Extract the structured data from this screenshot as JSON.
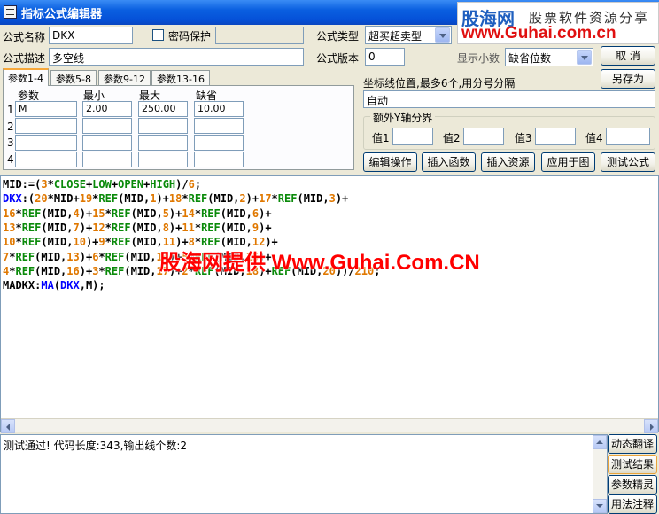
{
  "window": {
    "title": "指标公式编辑器"
  },
  "watermark": {
    "logo": "股海网",
    "tagline": "股票软件资源分享",
    "url": "www.Guhai.com.cn",
    "overlay": "股海网提供 Www.Guhai.Com.CN"
  },
  "form": {
    "name_label": "公式名称",
    "name_value": "DKX",
    "password_label": "密码保护",
    "type_label": "公式类型",
    "type_value": "超买超卖型",
    "desc_label": "公式描述",
    "desc_value": "多空线",
    "version_label": "公式版本",
    "version_value": "0",
    "decimal_label": "显示小数",
    "decimal_value": "缺省位数"
  },
  "buttons": {
    "cancel": "取 消",
    "save_as": "另存为",
    "edit_ops": "编辑操作",
    "insert_func": "插入函数",
    "insert_resource": "插入资源",
    "apply_chart": "应用于图",
    "test_formula": "测试公式",
    "dyn_translate": "动态翻译",
    "test_result": "测试结果",
    "param_wizard": "参数精灵",
    "usage_notes": "用法注释"
  },
  "tabs": [
    "参数1-4",
    "参数5-8",
    "参数9-12",
    "参数13-16"
  ],
  "params": {
    "headers": [
      "参数",
      "最小",
      "最大",
      "缺省"
    ],
    "rows": [
      {
        "idx": "1",
        "name": "M",
        "min": "2.00",
        "max": "250.00",
        "def": "10.00"
      },
      {
        "idx": "2",
        "name": "",
        "min": "",
        "max": "",
        "def": ""
      },
      {
        "idx": "3",
        "name": "",
        "min": "",
        "max": "",
        "def": ""
      },
      {
        "idx": "4",
        "name": "",
        "min": "",
        "max": "",
        "def": ""
      }
    ]
  },
  "axis": {
    "label": "坐标线位置,最多6个,用分号分隔",
    "value": "自动",
    "group_title": "额外Y轴分界",
    "v1": "值1",
    "v2": "值2",
    "v3": "值3",
    "v4": "值4"
  },
  "code_lines": [
    [
      [
        "p",
        "MID:=("
      ],
      [
        "n",
        "3"
      ],
      [
        "p",
        "*"
      ],
      [
        "v",
        "CLOSE"
      ],
      [
        "p",
        "+"
      ],
      [
        "v",
        "LOW"
      ],
      [
        "p",
        "+"
      ],
      [
        "v",
        "OPEN"
      ],
      [
        "p",
        "+"
      ],
      [
        "v",
        "HIGH"
      ],
      [
        "p",
        ")/"
      ],
      [
        "n",
        "6"
      ],
      [
        "p",
        ";"
      ]
    ],
    [
      [
        "f",
        "DKX"
      ],
      [
        "p",
        ":("
      ],
      [
        "n",
        "20"
      ],
      [
        "p",
        "*MID+"
      ],
      [
        "n",
        "19"
      ],
      [
        "p",
        "*"
      ],
      [
        "v",
        "REF"
      ],
      [
        "p",
        "(MID,"
      ],
      [
        "n",
        "1"
      ],
      [
        "p",
        ")+"
      ],
      [
        "n",
        "18"
      ],
      [
        "p",
        "*"
      ],
      [
        "v",
        "REF"
      ],
      [
        "p",
        "(MID,"
      ],
      [
        "n",
        "2"
      ],
      [
        "p",
        ")+"
      ],
      [
        "n",
        "17"
      ],
      [
        "p",
        "*"
      ],
      [
        "v",
        "REF"
      ],
      [
        "p",
        "(MID,"
      ],
      [
        "n",
        "3"
      ],
      [
        "p",
        ")+"
      ]
    ],
    [
      [
        "n",
        "16"
      ],
      [
        "p",
        "*"
      ],
      [
        "v",
        "REF"
      ],
      [
        "p",
        "(MID,"
      ],
      [
        "n",
        "4"
      ],
      [
        "p",
        ")+"
      ],
      [
        "n",
        "15"
      ],
      [
        "p",
        "*"
      ],
      [
        "v",
        "REF"
      ],
      [
        "p",
        "(MID,"
      ],
      [
        "n",
        "5"
      ],
      [
        "p",
        ")+"
      ],
      [
        "n",
        "14"
      ],
      [
        "p",
        "*"
      ],
      [
        "v",
        "REF"
      ],
      [
        "p",
        "(MID,"
      ],
      [
        "n",
        "6"
      ],
      [
        "p",
        ")+"
      ]
    ],
    [
      [
        "n",
        "13"
      ],
      [
        "p",
        "*"
      ],
      [
        "v",
        "REF"
      ],
      [
        "p",
        "(MID,"
      ],
      [
        "n",
        "7"
      ],
      [
        "p",
        ")+"
      ],
      [
        "n",
        "12"
      ],
      [
        "p",
        "*"
      ],
      [
        "v",
        "REF"
      ],
      [
        "p",
        "(MID,"
      ],
      [
        "n",
        "8"
      ],
      [
        "p",
        ")+"
      ],
      [
        "n",
        "11"
      ],
      [
        "p",
        "*"
      ],
      [
        "v",
        "REF"
      ],
      [
        "p",
        "(MID,"
      ],
      [
        "n",
        "9"
      ],
      [
        "p",
        ")+"
      ]
    ],
    [
      [
        "n",
        "10"
      ],
      [
        "p",
        "*"
      ],
      [
        "v",
        "REF"
      ],
      [
        "p",
        "(MID,"
      ],
      [
        "n",
        "10"
      ],
      [
        "p",
        ")+"
      ],
      [
        "n",
        "9"
      ],
      [
        "p",
        "*"
      ],
      [
        "v",
        "REF"
      ],
      [
        "p",
        "(MID,"
      ],
      [
        "n",
        "11"
      ],
      [
        "p",
        ")+"
      ],
      [
        "n",
        "8"
      ],
      [
        "p",
        "*"
      ],
      [
        "v",
        "REF"
      ],
      [
        "p",
        "(MID,"
      ],
      [
        "n",
        "12"
      ],
      [
        "p",
        ")+"
      ]
    ],
    [
      [
        "n",
        "7"
      ],
      [
        "p",
        "*"
      ],
      [
        "v",
        "REF"
      ],
      [
        "p",
        "(MID,"
      ],
      [
        "n",
        "13"
      ],
      [
        "p",
        ")+"
      ],
      [
        "n",
        "6"
      ],
      [
        "p",
        "*"
      ],
      [
        "v",
        "REF"
      ],
      [
        "p",
        "(MID,"
      ],
      [
        "n",
        "14"
      ],
      [
        "p",
        ")+"
      ],
      [
        "n",
        "5"
      ],
      [
        "p",
        "*"
      ],
      [
        "v",
        "REF"
      ],
      [
        "p",
        "(MID,"
      ],
      [
        "n",
        "15"
      ],
      [
        "p",
        ")+"
      ]
    ],
    [
      [
        "n",
        "4"
      ],
      [
        "p",
        "*"
      ],
      [
        "v",
        "REF"
      ],
      [
        "p",
        "(MID,"
      ],
      [
        "n",
        "16"
      ],
      [
        "p",
        ")+"
      ],
      [
        "n",
        "3"
      ],
      [
        "p",
        "*"
      ],
      [
        "v",
        "REF"
      ],
      [
        "p",
        "(MID,"
      ],
      [
        "n",
        "17"
      ],
      [
        "p",
        ")+"
      ],
      [
        "n",
        "2"
      ],
      [
        "p",
        "*"
      ],
      [
        "v",
        "REF"
      ],
      [
        "p",
        "(MID,"
      ],
      [
        "n",
        "18"
      ],
      [
        "p",
        ")+"
      ],
      [
        "v",
        "REF"
      ],
      [
        "p",
        "(MID,"
      ],
      [
        "n",
        "20"
      ],
      [
        "p",
        "))/"
      ],
      [
        "n",
        "210"
      ],
      [
        "p",
        ";"
      ]
    ],
    [
      [
        "p",
        "MADKX:"
      ],
      [
        "f",
        "MA"
      ],
      [
        "p",
        "("
      ],
      [
        "f",
        "DKX"
      ],
      [
        "p",
        ",M);"
      ]
    ]
  ],
  "output": {
    "message": "测试通过! 代码长度:343,输出线个数:2"
  }
}
